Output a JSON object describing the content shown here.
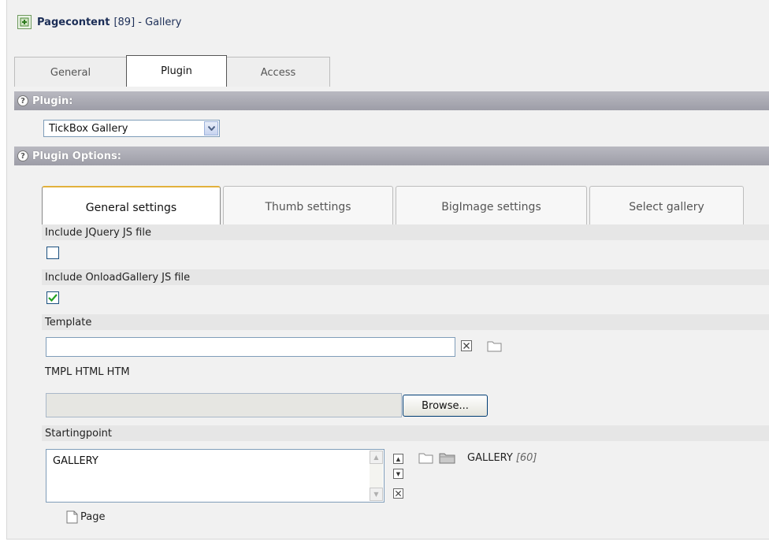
{
  "header": {
    "title": "Pagecontent",
    "rest": "[89] - Gallery",
    "icon": "page-content-icon"
  },
  "tabs": [
    "General",
    "Plugin",
    "Access"
  ],
  "active_tab": "Plugin",
  "plugin_section": {
    "label": "Plugin:",
    "selected": "TickBox Gallery"
  },
  "options_section": {
    "label": "Plugin Options:"
  },
  "settings_tabs": [
    "General settings",
    "Thumb settings",
    "BigImage settings",
    "Select gallery"
  ],
  "active_settings_tab": "General settings",
  "fields": {
    "include_jquery": {
      "label": "Include JQuery JS file",
      "checked": false
    },
    "include_onload": {
      "label": "Include OnloadGallery JS file",
      "checked": true
    },
    "template": {
      "label": "Template",
      "value": ""
    },
    "tmpl_types": {
      "label": "TMPL HTML HTM",
      "browse_label": "Browse..."
    },
    "startingpoint": {
      "label": "Startingpoint",
      "list_items": [
        "GALLERY"
      ],
      "selected_name": "GALLERY",
      "selected_id": "[60]",
      "page_label": "Page"
    }
  },
  "colors": {
    "bar": "#a8a8b2",
    "row": "#e6e6e6",
    "active_tab_accent": "#e2b13c",
    "header_text": "#1c2e57"
  }
}
